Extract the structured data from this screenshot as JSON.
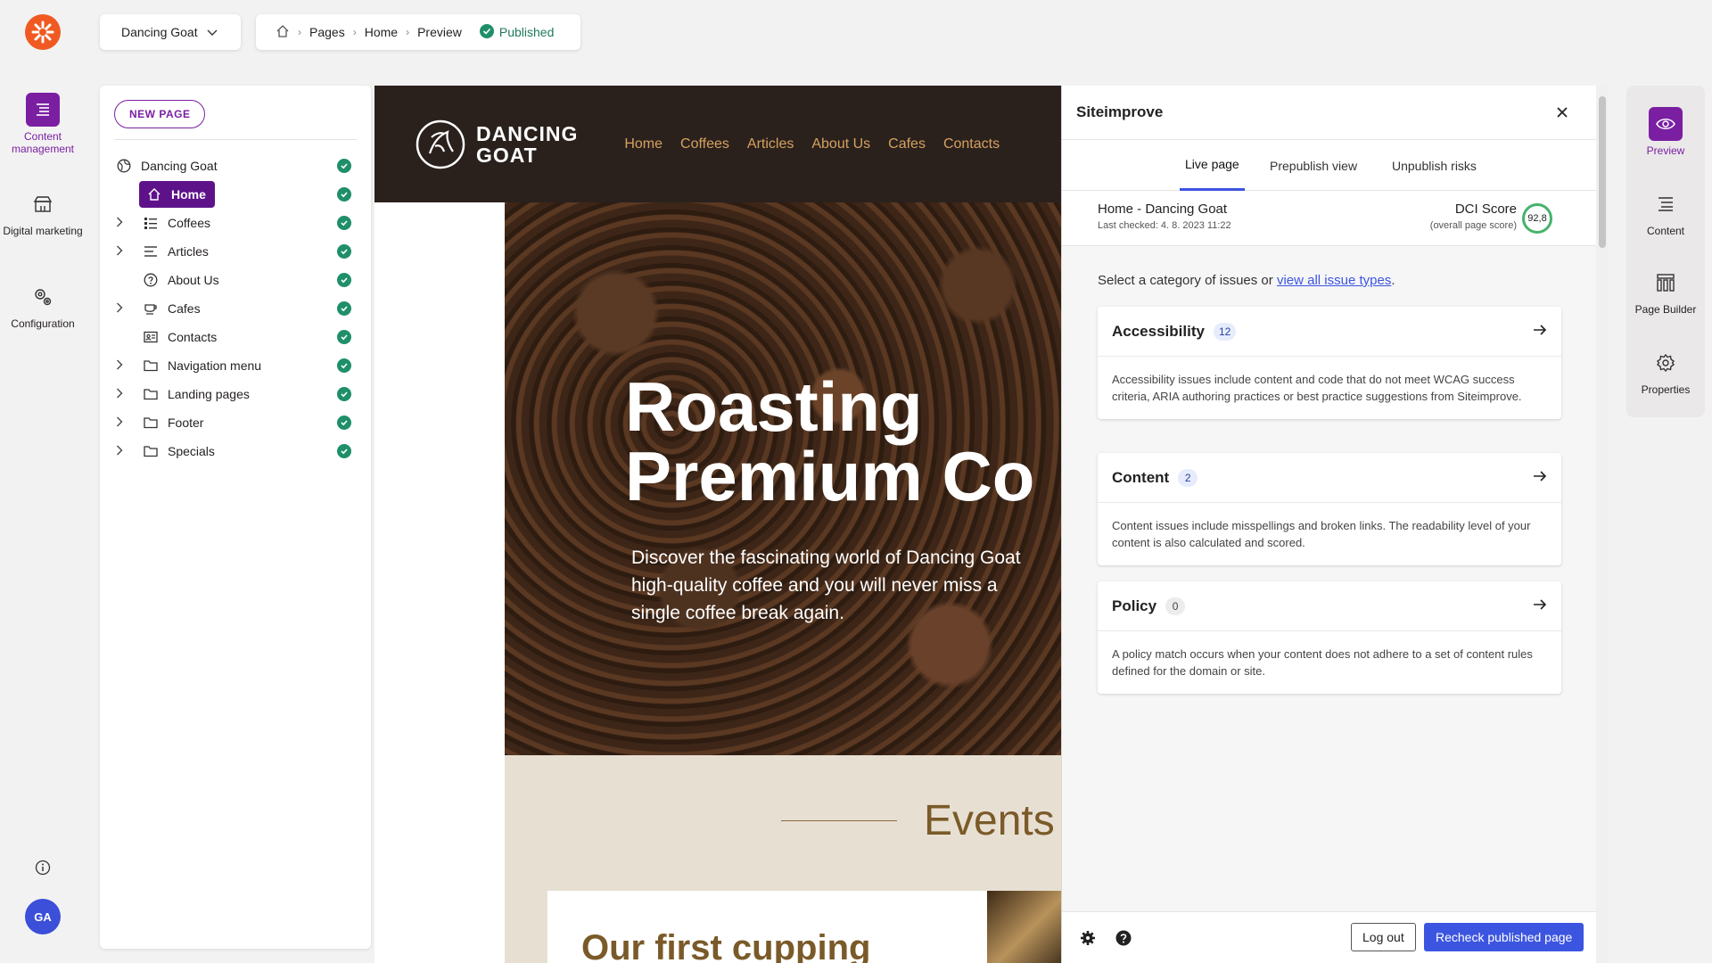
{
  "app": {
    "rail": [
      {
        "label": "Content management",
        "icon": "content-management-icon",
        "active": true
      },
      {
        "label": "Digital marketing",
        "icon": "storefront-icon",
        "active": false
      },
      {
        "label": "Configuration",
        "icon": "configuration-gears-icon",
        "active": false
      }
    ],
    "avatar_initials": "GA",
    "accent_color": "#7a1fa2"
  },
  "topbar": {
    "site_selector": "Dancing Goat",
    "breadcrumb": [
      "Pages",
      "Home",
      "Preview"
    ],
    "status": "Published"
  },
  "tree": {
    "new_page_label": "NEW PAGE",
    "root": "Dancing Goat",
    "items": [
      {
        "label": "Home",
        "expandable": false,
        "icon": "home-icon",
        "selected": true
      },
      {
        "label": "Coffees",
        "expandable": true,
        "icon": "list-grid-icon"
      },
      {
        "label": "Articles",
        "expandable": true,
        "icon": "lines-icon"
      },
      {
        "label": "About Us",
        "expandable": false,
        "icon": "question-circle-icon"
      },
      {
        "label": "Cafes",
        "expandable": true,
        "icon": "cup-icon"
      },
      {
        "label": "Contacts",
        "expandable": false,
        "icon": "contact-card-icon"
      },
      {
        "label": "Navigation menu",
        "expandable": true,
        "icon": "folder-icon"
      },
      {
        "label": "Landing pages",
        "expandable": true,
        "icon": "folder-icon"
      },
      {
        "label": "Footer",
        "expandable": true,
        "icon": "folder-icon"
      },
      {
        "label": "Specials",
        "expandable": true,
        "icon": "folder-icon"
      }
    ]
  },
  "site": {
    "logo_line1": "DANCING",
    "logo_line2": "GOAT",
    "nav": [
      "Home",
      "Coffees",
      "Articles",
      "About Us",
      "Cafes",
      "Contacts"
    ],
    "hero_line1": "Roasting",
    "hero_line2": "Premium Co",
    "hero_sub": "Discover the fascinating world of Dancing Goat high-quality coffee and you will never miss a single coffee break again.",
    "events_title": "Events",
    "event_card_title": "Our first cupping"
  },
  "siteimprove": {
    "title": "Siteimprove",
    "tabs": [
      "Live page",
      "Prepublish view",
      "Unpublish risks"
    ],
    "page_name": "Home - Dancing Goat",
    "last_checked": "Last checked: 4. 8. 2023 11:22",
    "dci_label": "DCI Score",
    "dci_sub": "(overall page score)",
    "dci_value": "92,8",
    "select_text": "Select a category of issues or ",
    "select_link": "view all issue types",
    "select_end": ".",
    "categories": [
      {
        "name": "Accessibility",
        "count": "12",
        "badge_color": "#e6ecfb",
        "description": "Accessibility issues include content and code that do not meet WCAG success criteria, ARIA authoring practices or best practice suggestions from Siteimprove."
      },
      {
        "name": "Content",
        "count": "2",
        "badge_color": "#e6ecfb",
        "description": "Content issues include misspellings and broken links. The readability level of your content is also calculated and scored."
      },
      {
        "name": "Policy",
        "count": "0",
        "badge_color": "#ececec",
        "description": "A policy match occurs when your content does not adhere to a set of content rules defined for the domain or site."
      }
    ],
    "logout_label": "Log out",
    "recheck_label": "Recheck published page"
  },
  "right_rail": [
    {
      "label": "Preview",
      "icon": "eye-icon",
      "active": true
    },
    {
      "label": "Content",
      "icon": "content-lines-icon",
      "active": false
    },
    {
      "label": "Page Builder",
      "icon": "page-builder-icon",
      "active": false
    },
    {
      "label": "Properties",
      "icon": "gear-icon",
      "active": false
    }
  ]
}
